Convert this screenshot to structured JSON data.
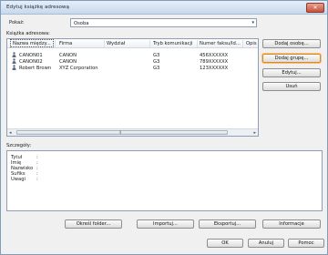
{
  "window": {
    "title": "Edytuj książkę adresową",
    "close_label": "✕"
  },
  "filter": {
    "label": "Pokaż:",
    "selected": "Osoba"
  },
  "addressbook": {
    "label": "Książka adresowa:",
    "columns": [
      "Nazwa między...",
      "Firma",
      "Wydział",
      "Tryb komunikacji",
      "Numer faksu/Id...",
      "Opis"
    ],
    "rows": [
      {
        "name": "CANON01",
        "company": "CANON",
        "mode": "G3",
        "number": "456XXXXXX"
      },
      {
        "name": "CANON02",
        "company": "CANON",
        "mode": "G3",
        "number": "789XXXXXX"
      },
      {
        "name": "Robert Brown",
        "company": "XYZ Corporation",
        "mode": "G3",
        "number": "123XXXXXX"
      }
    ]
  },
  "side_buttons": {
    "add_person": "Dodaj osobę...",
    "add_group": "Dodaj grupę...",
    "edit": "Edytuj...",
    "delete": "Usuń"
  },
  "details": {
    "label": "Szczegóły:",
    "fields": [
      "Tytuł",
      "Imię",
      "Nazwisko",
      "Sufiks",
      "Uwagi"
    ],
    "colon": ":"
  },
  "bottom_buttons": {
    "select_folder": "Określ folder...",
    "import": "Importuj...",
    "export": "Eksportuj...",
    "information": "Informacje"
  },
  "dialog_buttons": {
    "ok": "OK",
    "cancel": "Anuluj",
    "help": "Pomoc"
  },
  "scroll": {
    "left": "◂",
    "right": "▸",
    "grip": "⦀"
  },
  "combo_arrow": "▾",
  "colors": {
    "focus": "#e0881c",
    "window_bg": "#f0f0f0",
    "border": "#8d9fb5"
  }
}
